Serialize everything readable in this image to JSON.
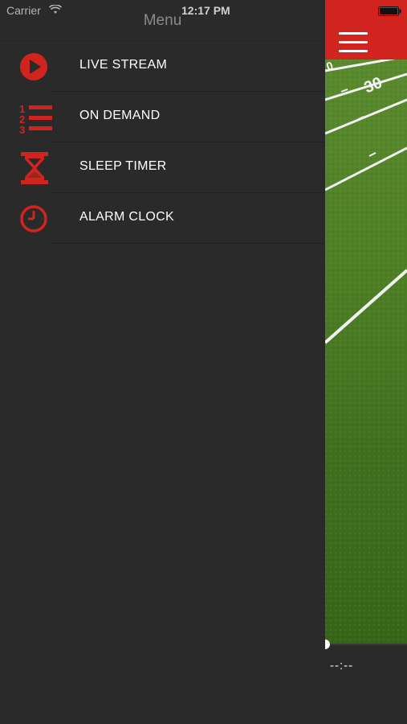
{
  "status_bar": {
    "carrier": "Carrier",
    "time": "12:17 PM"
  },
  "menu": {
    "title": "Menu",
    "items": [
      {
        "label": "LIVE STREAM",
        "icon": "play-circle-icon"
      },
      {
        "label": "ON DEMAND",
        "icon": "numbered-list-icon"
      },
      {
        "label": "SLEEP TIMER",
        "icon": "hourglass-icon"
      },
      {
        "label": "ALARM CLOCK",
        "icon": "clock-icon"
      }
    ]
  },
  "main": {
    "menu_button": "hamburger-menu-icon",
    "field_yard_marker": "30",
    "player": {
      "time_readout": "--:--",
      "progress": 0
    }
  },
  "colors": {
    "accent": "#d2241e",
    "background": "#2a2a2a",
    "text": "#ffffff",
    "title": "#8a8a8a"
  }
}
